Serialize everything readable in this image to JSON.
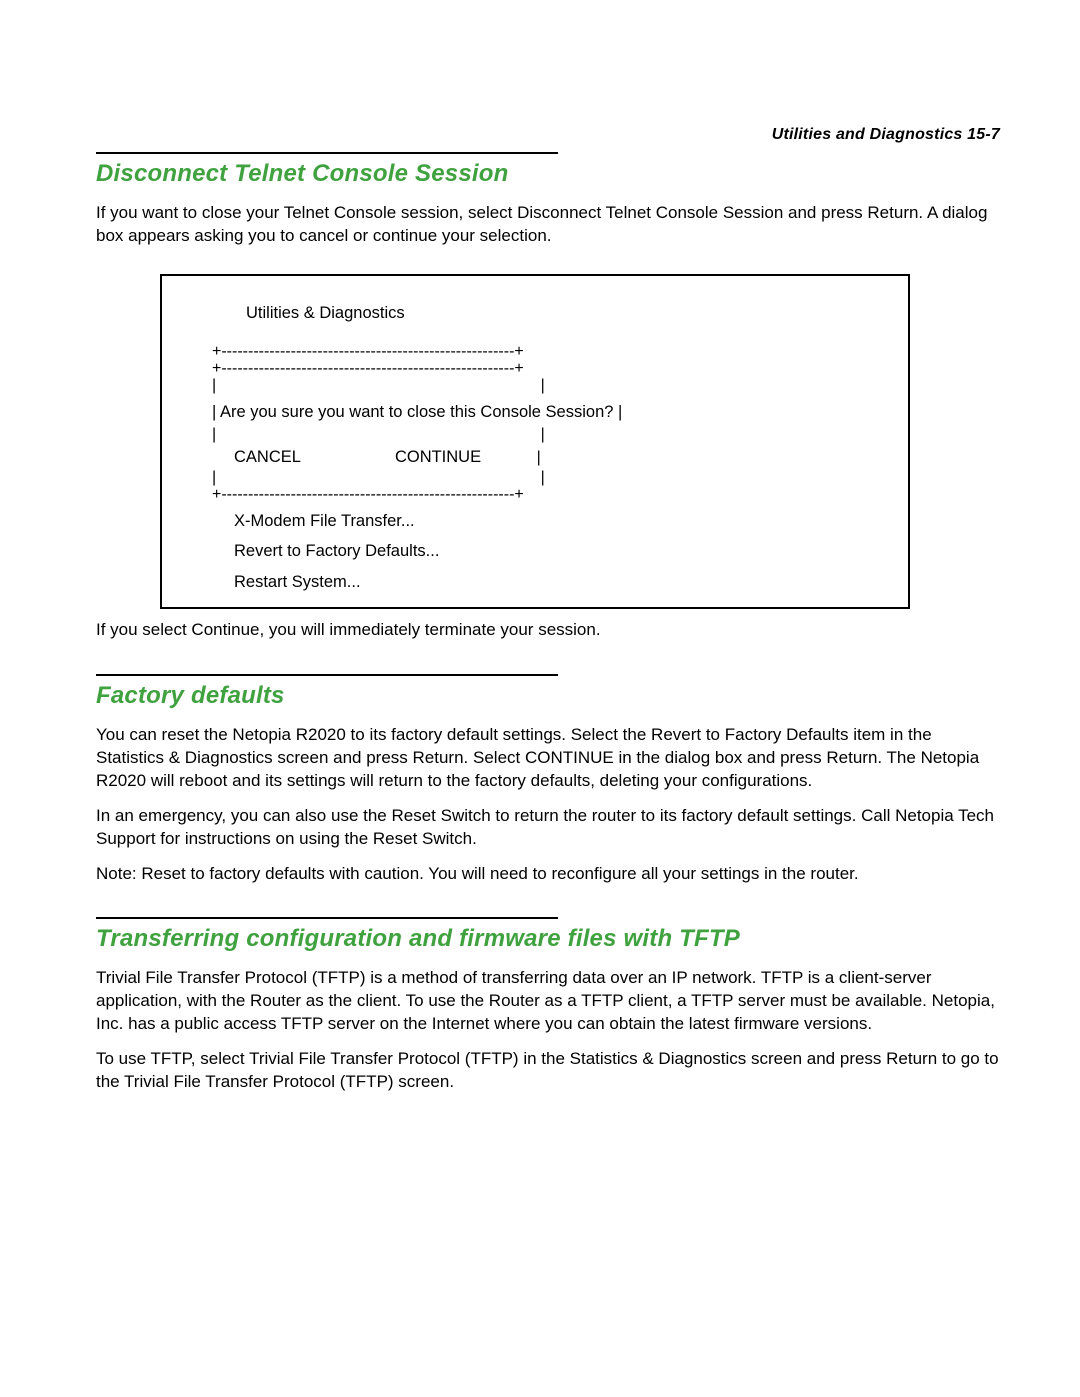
{
  "running_head": "Utilities and Diagnostics  15-7",
  "sections": {
    "disconnect": {
      "title": "Disconnect Telnet Console Session",
      "para1": "If you want to close your Telnet Console session, select Disconnect Telnet Console Session and press Return. A dialog box appears asking you to cancel or continue your selection.",
      "after_box": "If you select Continue, you will immediately terminate your session."
    },
    "factory": {
      "title": "Factory defaults",
      "para1": "You can reset the Netopia R2020 to its factory default settings. Select the Revert to Factory Defaults item in the Statistics & Diagnostics screen and press Return. Select CONTINUE in the dialog box and press Return. The Netopia R2020 will reboot and its settings will return to the factory defaults, deleting your configurations.",
      "para2": "In an emergency, you can also use the Reset Switch to return the router to its factory default settings. Call Netopia Tech Support for instructions on using the Reset Switch.",
      "para3": "Note: Reset to factory defaults with caution. You will need to reconfigure all your settings in the router."
    },
    "tftp": {
      "title": "Transferring configuration and firmware files with TFTP",
      "para1": "Trivial File Transfer Protocol (TFTP) is a method of transferring data over an IP network. TFTP is a client-server application, with the Router as the client. To use the Router as a TFTP client, a TFTP server must be available. Netopia, Inc. has a public access TFTP server on the Internet where you can obtain the latest firmware versions.",
      "para2": "To use TFTP, select Trivial File Transfer Protocol (TFTP) in the Statistics & Diagnostics screen and press Return to go to the Trivial File Transfer Protocol (TFTP) screen."
    }
  },
  "terminal": {
    "title": "Utilities & Diagnostics",
    "border_top1": "+-------------------------------------------------------+",
    "border_top2": "+-------------------------------------------------------+",
    "pipe_only": "|                                                                         |",
    "prompt_line": "| Are you sure you want to close this Console Session? |",
    "buttons_trail": "        |",
    "cancel": "CANCEL",
    "continue": "CONTINUE",
    "border_bottom": "+-------------------------------------------------------+",
    "menu": {
      "xmodem": "X-Modem File Transfer...",
      "revert": "Revert to Factory Defaults...",
      "restart": "Restart System..."
    }
  }
}
